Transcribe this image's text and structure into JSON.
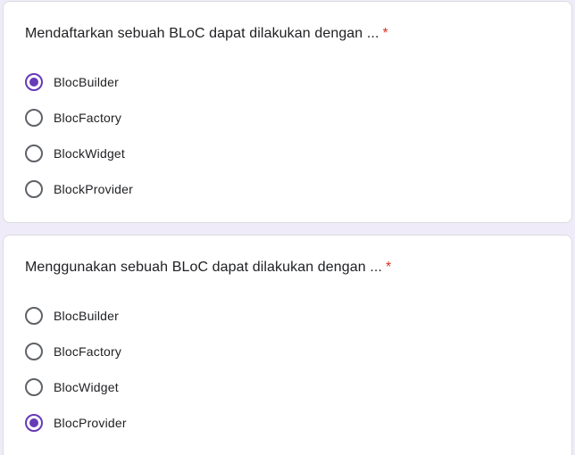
{
  "colors": {
    "accent": "#673ab7",
    "required": "#d93025",
    "unselected_radio": "#5f6368",
    "background": "#f0ebf8"
  },
  "questions": [
    {
      "title": "Mendaftarkan sebuah BLoC dapat dilakukan dengan ...",
      "required_mark": "*",
      "options": [
        {
          "label": "BlocBuilder",
          "selected": true
        },
        {
          "label": "BlocFactory",
          "selected": false
        },
        {
          "label": "BlockWidget",
          "selected": false
        },
        {
          "label": "BlockProvider",
          "selected": false
        }
      ]
    },
    {
      "title": "Menggunakan sebuah BLoC dapat dilakukan dengan ...",
      "required_mark": "*",
      "options": [
        {
          "label": "BlocBuilder",
          "selected": false
        },
        {
          "label": "BlocFactory",
          "selected": false
        },
        {
          "label": "BlocWidget",
          "selected": false
        },
        {
          "label": "BlocProvider",
          "selected": true
        }
      ]
    }
  ]
}
